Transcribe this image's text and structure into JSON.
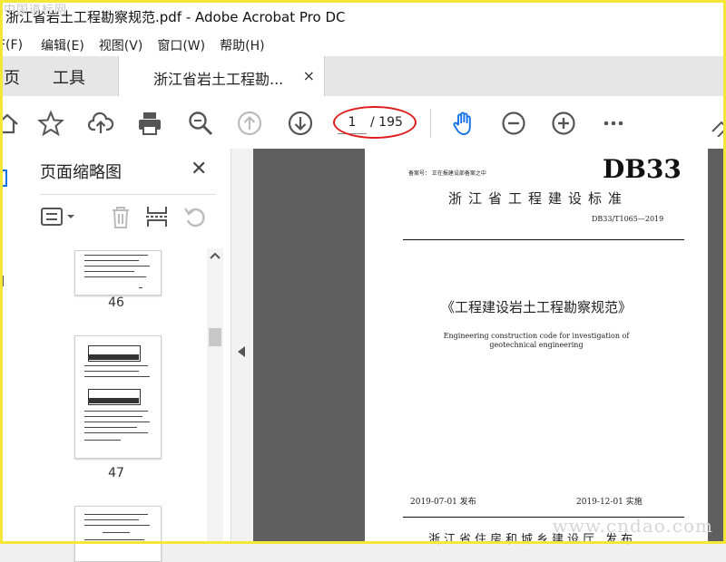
{
  "window": {
    "title": "浙江省岩土工程勘察规范.pdf - Adobe Acrobat Pro DC"
  },
  "menu": [
    "F(F)",
    "编辑(E)",
    "视图(V)",
    "窗口(W)",
    "帮助(H)"
  ],
  "tabs": {
    "home": "页",
    "tools": "工具",
    "doc": "浙江省岩土工程勘...",
    "close": "×"
  },
  "toolbar": {
    "icons": [
      "home-icon",
      "star-icon",
      "cloud-upload-icon",
      "print-icon",
      "zoom-search-icon",
      "page-up-icon",
      "page-down-icon",
      "hand-tool-icon",
      "zoom-out-icon",
      "zoom-in-icon",
      "more-icon"
    ],
    "page_current": "1",
    "page_total": "/ 195"
  },
  "panel": {
    "title": "页面缩略图",
    "close": "✕",
    "thumbnails": [
      {
        "page": "46"
      },
      {
        "page": "47"
      }
    ]
  },
  "document": {
    "record_no": "备案号：       正在报建设部备案之中",
    "db": "DB33",
    "standard": "浙江省工程建设标准",
    "code": "DB33/T1065—2019",
    "title": "《工程建设岩土工程勘察规范》",
    "english_1": "Engineering construction code for investigation of",
    "english_2": "geotechnical engineering",
    "publish_date": "2019-07-01   发布",
    "effective_date": "2019-12-01   实施",
    "issuer": "浙江省住房和城乡建设厅      发布"
  },
  "watermarks": {
    "top_left": "中国道标网",
    "bottom_right": "www.cndao.com"
  },
  "colors": {
    "highlight_circle": "#e01b1b",
    "hand_tool": "#1473e6",
    "frame": "#f5e63a"
  }
}
